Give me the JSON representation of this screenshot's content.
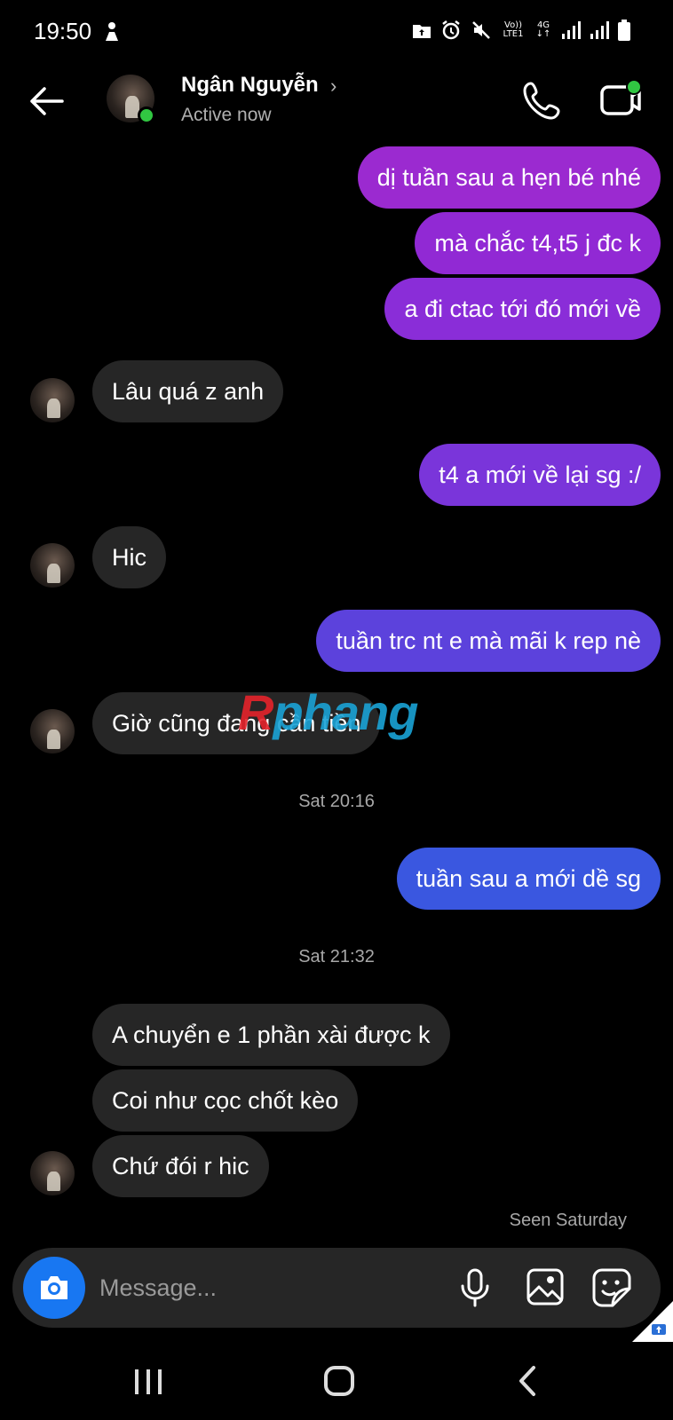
{
  "status_bar": {
    "time": "19:50",
    "network_label_top": "Vo)) LTE1",
    "network_label_4g": "4G"
  },
  "header": {
    "contact_name": "Ngân Nguyễn",
    "name_chevron": "›",
    "contact_status": "Active now"
  },
  "messages": [
    {
      "direction": "out",
      "text": "dị tuần sau a hẹn bé nhé",
      "color": "#9b2ad0"
    },
    {
      "direction": "out",
      "text": "mà chắc t4,t5 j đc k",
      "color": "#9129d4"
    },
    {
      "direction": "out",
      "text": "a đi ctac tới đó mới về",
      "color": "#8a2dd8"
    },
    {
      "direction": "in",
      "text": "Lâu quá z anh"
    },
    {
      "direction": "out",
      "text": "t4 a mới về lại sg :/",
      "color": "#7a35da"
    },
    {
      "direction": "in",
      "text": "Hic"
    },
    {
      "direction": "out",
      "text": "tuần trc nt e mà mãi k rep nè",
      "color": "#5c42dc"
    },
    {
      "direction": "in",
      "text": "Giờ cũng đang cần tiền"
    },
    {
      "direction": "out",
      "text": "tuần sau a mới dề sg",
      "color": "#3a57e0"
    },
    {
      "direction": "in",
      "text": "A chuyển e 1 phần xài được k"
    },
    {
      "direction": "in",
      "text": "Coi như cọc chốt kèo"
    },
    {
      "direction": "in",
      "text": "Chứ đói r hic"
    }
  ],
  "timestamps": [
    "Sat 20:16",
    "Sat 21:32"
  ],
  "seen_label": "Seen Saturday",
  "watermark": {
    "part1": "R",
    "part2": "phang"
  },
  "composer": {
    "placeholder": "Message..."
  },
  "colors": {
    "incoming_bubble": "#262626",
    "online": "#31c742",
    "camera_button": "#1877f2"
  }
}
